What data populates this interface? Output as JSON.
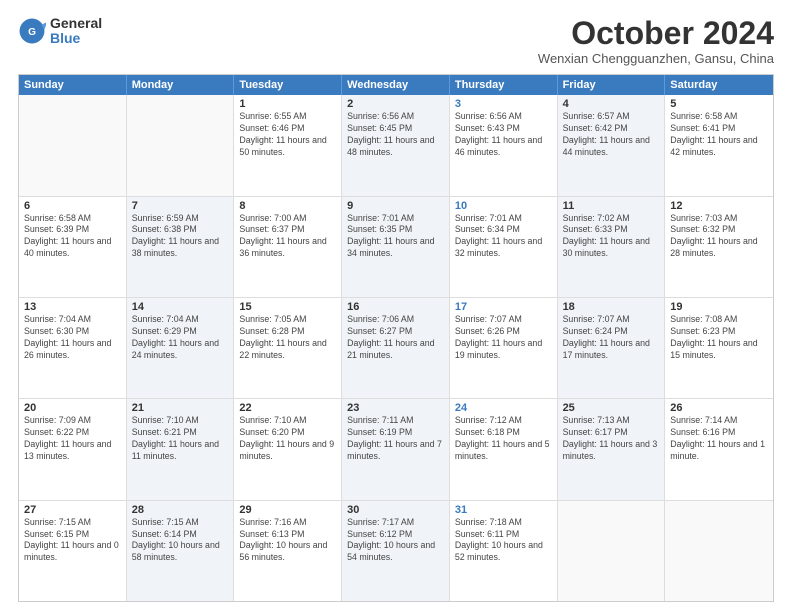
{
  "logo": {
    "general": "General",
    "blue": "Blue"
  },
  "title": {
    "month": "October 2024",
    "location": "Wenxian Chengguanzhen, Gansu, China"
  },
  "header_days": [
    "Sunday",
    "Monday",
    "Tuesday",
    "Wednesday",
    "Thursday",
    "Friday",
    "Saturday"
  ],
  "weeks": [
    [
      {
        "day": "",
        "sunrise": "",
        "sunset": "",
        "daylight": "",
        "shaded": false,
        "empty": true
      },
      {
        "day": "",
        "sunrise": "",
        "sunset": "",
        "daylight": "",
        "shaded": false,
        "empty": true
      },
      {
        "day": "1",
        "sunrise": "Sunrise: 6:55 AM",
        "sunset": "Sunset: 6:46 PM",
        "daylight": "Daylight: 11 hours and 50 minutes.",
        "shaded": false,
        "empty": false,
        "thursday": false
      },
      {
        "day": "2",
        "sunrise": "Sunrise: 6:56 AM",
        "sunset": "Sunset: 6:45 PM",
        "daylight": "Daylight: 11 hours and 48 minutes.",
        "shaded": true,
        "empty": false,
        "thursday": false
      },
      {
        "day": "3",
        "sunrise": "Sunrise: 6:56 AM",
        "sunset": "Sunset: 6:43 PM",
        "daylight": "Daylight: 11 hours and 46 minutes.",
        "shaded": false,
        "empty": false,
        "thursday": true
      },
      {
        "day": "4",
        "sunrise": "Sunrise: 6:57 AM",
        "sunset": "Sunset: 6:42 PM",
        "daylight": "Daylight: 11 hours and 44 minutes.",
        "shaded": true,
        "empty": false,
        "thursday": false
      },
      {
        "day": "5",
        "sunrise": "Sunrise: 6:58 AM",
        "sunset": "Sunset: 6:41 PM",
        "daylight": "Daylight: 11 hours and 42 minutes.",
        "shaded": false,
        "empty": false,
        "thursday": false
      }
    ],
    [
      {
        "day": "6",
        "sunrise": "Sunrise: 6:58 AM",
        "sunset": "Sunset: 6:39 PM",
        "daylight": "Daylight: 11 hours and 40 minutes.",
        "shaded": false,
        "empty": false,
        "thursday": false
      },
      {
        "day": "7",
        "sunrise": "Sunrise: 6:59 AM",
        "sunset": "Sunset: 6:38 PM",
        "daylight": "Daylight: 11 hours and 38 minutes.",
        "shaded": true,
        "empty": false,
        "thursday": false
      },
      {
        "day": "8",
        "sunrise": "Sunrise: 7:00 AM",
        "sunset": "Sunset: 6:37 PM",
        "daylight": "Daylight: 11 hours and 36 minutes.",
        "shaded": false,
        "empty": false,
        "thursday": false
      },
      {
        "day": "9",
        "sunrise": "Sunrise: 7:01 AM",
        "sunset": "Sunset: 6:35 PM",
        "daylight": "Daylight: 11 hours and 34 minutes.",
        "shaded": true,
        "empty": false,
        "thursday": false
      },
      {
        "day": "10",
        "sunrise": "Sunrise: 7:01 AM",
        "sunset": "Sunset: 6:34 PM",
        "daylight": "Daylight: 11 hours and 32 minutes.",
        "shaded": false,
        "empty": false,
        "thursday": true
      },
      {
        "day": "11",
        "sunrise": "Sunrise: 7:02 AM",
        "sunset": "Sunset: 6:33 PM",
        "daylight": "Daylight: 11 hours and 30 minutes.",
        "shaded": true,
        "empty": false,
        "thursday": false
      },
      {
        "day": "12",
        "sunrise": "Sunrise: 7:03 AM",
        "sunset": "Sunset: 6:32 PM",
        "daylight": "Daylight: 11 hours and 28 minutes.",
        "shaded": false,
        "empty": false,
        "thursday": false
      }
    ],
    [
      {
        "day": "13",
        "sunrise": "Sunrise: 7:04 AM",
        "sunset": "Sunset: 6:30 PM",
        "daylight": "Daylight: 11 hours and 26 minutes.",
        "shaded": false,
        "empty": false,
        "thursday": false
      },
      {
        "day": "14",
        "sunrise": "Sunrise: 7:04 AM",
        "sunset": "Sunset: 6:29 PM",
        "daylight": "Daylight: 11 hours and 24 minutes.",
        "shaded": true,
        "empty": false,
        "thursday": false
      },
      {
        "day": "15",
        "sunrise": "Sunrise: 7:05 AM",
        "sunset": "Sunset: 6:28 PM",
        "daylight": "Daylight: 11 hours and 22 minutes.",
        "shaded": false,
        "empty": false,
        "thursday": false
      },
      {
        "day": "16",
        "sunrise": "Sunrise: 7:06 AM",
        "sunset": "Sunset: 6:27 PM",
        "daylight": "Daylight: 11 hours and 21 minutes.",
        "shaded": true,
        "empty": false,
        "thursday": false
      },
      {
        "day": "17",
        "sunrise": "Sunrise: 7:07 AM",
        "sunset": "Sunset: 6:26 PM",
        "daylight": "Daylight: 11 hours and 19 minutes.",
        "shaded": false,
        "empty": false,
        "thursday": true
      },
      {
        "day": "18",
        "sunrise": "Sunrise: 7:07 AM",
        "sunset": "Sunset: 6:24 PM",
        "daylight": "Daylight: 11 hours and 17 minutes.",
        "shaded": true,
        "empty": false,
        "thursday": false
      },
      {
        "day": "19",
        "sunrise": "Sunrise: 7:08 AM",
        "sunset": "Sunset: 6:23 PM",
        "daylight": "Daylight: 11 hours and 15 minutes.",
        "shaded": false,
        "empty": false,
        "thursday": false
      }
    ],
    [
      {
        "day": "20",
        "sunrise": "Sunrise: 7:09 AM",
        "sunset": "Sunset: 6:22 PM",
        "daylight": "Daylight: 11 hours and 13 minutes.",
        "shaded": false,
        "empty": false,
        "thursday": false
      },
      {
        "day": "21",
        "sunrise": "Sunrise: 7:10 AM",
        "sunset": "Sunset: 6:21 PM",
        "daylight": "Daylight: 11 hours and 11 minutes.",
        "shaded": true,
        "empty": false,
        "thursday": false
      },
      {
        "day": "22",
        "sunrise": "Sunrise: 7:10 AM",
        "sunset": "Sunset: 6:20 PM",
        "daylight": "Daylight: 11 hours and 9 minutes.",
        "shaded": false,
        "empty": false,
        "thursday": false
      },
      {
        "day": "23",
        "sunrise": "Sunrise: 7:11 AM",
        "sunset": "Sunset: 6:19 PM",
        "daylight": "Daylight: 11 hours and 7 minutes.",
        "shaded": true,
        "empty": false,
        "thursday": false
      },
      {
        "day": "24",
        "sunrise": "Sunrise: 7:12 AM",
        "sunset": "Sunset: 6:18 PM",
        "daylight": "Daylight: 11 hours and 5 minutes.",
        "shaded": false,
        "empty": false,
        "thursday": true
      },
      {
        "day": "25",
        "sunrise": "Sunrise: 7:13 AM",
        "sunset": "Sunset: 6:17 PM",
        "daylight": "Daylight: 11 hours and 3 minutes.",
        "shaded": true,
        "empty": false,
        "thursday": false
      },
      {
        "day": "26",
        "sunrise": "Sunrise: 7:14 AM",
        "sunset": "Sunset: 6:16 PM",
        "daylight": "Daylight: 11 hours and 1 minute.",
        "shaded": false,
        "empty": false,
        "thursday": false
      }
    ],
    [
      {
        "day": "27",
        "sunrise": "Sunrise: 7:15 AM",
        "sunset": "Sunset: 6:15 PM",
        "daylight": "Daylight: 11 hours and 0 minutes.",
        "shaded": false,
        "empty": false,
        "thursday": false
      },
      {
        "day": "28",
        "sunrise": "Sunrise: 7:15 AM",
        "sunset": "Sunset: 6:14 PM",
        "daylight": "Daylight: 10 hours and 58 minutes.",
        "shaded": true,
        "empty": false,
        "thursday": false
      },
      {
        "day": "29",
        "sunrise": "Sunrise: 7:16 AM",
        "sunset": "Sunset: 6:13 PM",
        "daylight": "Daylight: 10 hours and 56 minutes.",
        "shaded": false,
        "empty": false,
        "thursday": false
      },
      {
        "day": "30",
        "sunrise": "Sunrise: 7:17 AM",
        "sunset": "Sunset: 6:12 PM",
        "daylight": "Daylight: 10 hours and 54 minutes.",
        "shaded": true,
        "empty": false,
        "thursday": false
      },
      {
        "day": "31",
        "sunrise": "Sunrise: 7:18 AM",
        "sunset": "Sunset: 6:11 PM",
        "daylight": "Daylight: 10 hours and 52 minutes.",
        "shaded": false,
        "empty": false,
        "thursday": true
      },
      {
        "day": "",
        "sunrise": "",
        "sunset": "",
        "daylight": "",
        "shaded": true,
        "empty": true,
        "thursday": false
      },
      {
        "day": "",
        "sunrise": "",
        "sunset": "",
        "daylight": "",
        "shaded": false,
        "empty": true,
        "thursday": false
      }
    ]
  ]
}
